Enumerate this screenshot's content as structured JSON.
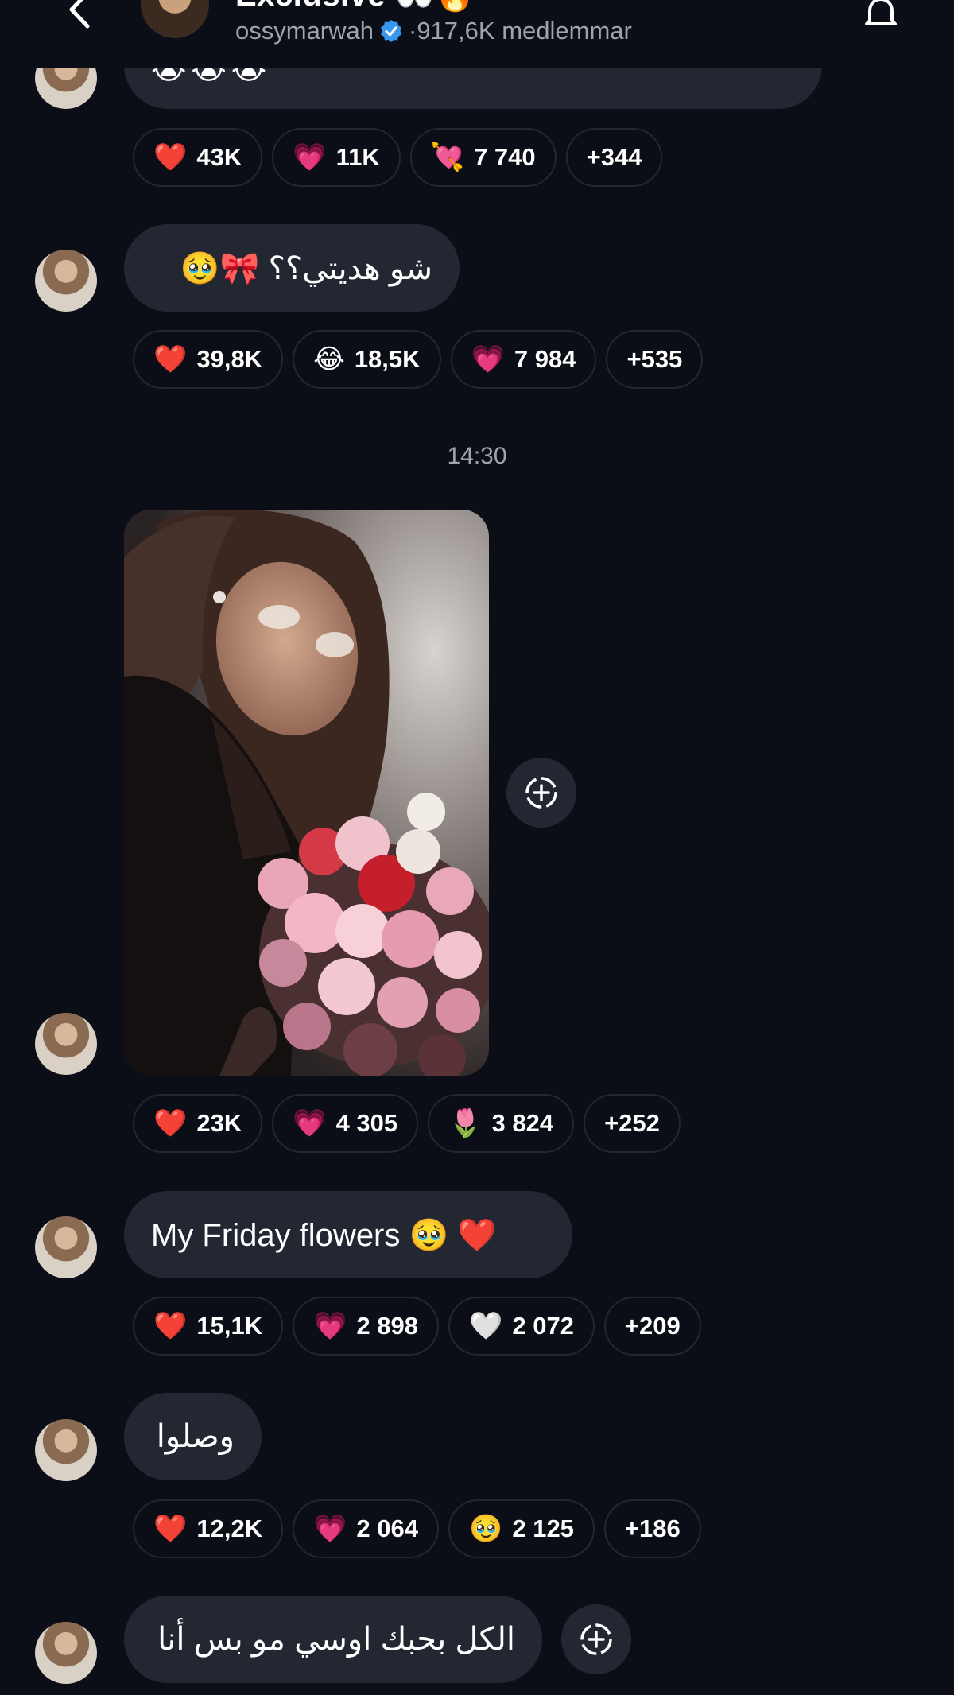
{
  "header": {
    "title": "Exclusive 👀🔥",
    "username": "ossymarwah",
    "members": "·917,6K medlemmar"
  },
  "colors": {
    "background": "#0b0e16",
    "bubble": "#232732",
    "muted_text": "#9ea3ad",
    "verified": "#3897f0"
  },
  "messages": [
    {
      "text": "😭😭😭",
      "reactions": [
        {
          "emoji": "❤️",
          "count": "43K"
        },
        {
          "emoji": "💗",
          "count": "11K"
        },
        {
          "emoji": "💘",
          "count": "7 740"
        },
        {
          "emoji": "",
          "count": "+344"
        }
      ]
    },
    {
      "text": "شو هديتي؟؟ 🎀🥹",
      "reactions": [
        {
          "emoji": "❤️",
          "count": "39,8K"
        },
        {
          "emoji": "😂",
          "count": "18,5K"
        },
        {
          "emoji": "💗",
          "count": "7 984"
        },
        {
          "emoji": "",
          "count": "+535"
        }
      ]
    },
    {
      "timestamp": "14:30",
      "photo": "selfie-with-flower-bouquet",
      "reactions": [
        {
          "emoji": "❤️",
          "count": "23K"
        },
        {
          "emoji": "💗",
          "count": "4 305"
        },
        {
          "emoji": "🌷",
          "count": "3 824"
        },
        {
          "emoji": "",
          "count": "+252"
        }
      ]
    },
    {
      "text": "My Friday flowers 🥹 ❤️",
      "reactions": [
        {
          "emoji": "❤️",
          "count": "15,1K"
        },
        {
          "emoji": "💗",
          "count": "2 898"
        },
        {
          "emoji": "🤍",
          "count": "2 072"
        },
        {
          "emoji": "",
          "count": "+209"
        }
      ]
    },
    {
      "text": "وصلوا",
      "reactions": [
        {
          "emoji": "❤️",
          "count": "12,2K"
        },
        {
          "emoji": "💗",
          "count": "2 064"
        },
        {
          "emoji": "🥹",
          "count": "2 125"
        },
        {
          "emoji": "",
          "count": "+186"
        }
      ]
    },
    {
      "text": "الكل بحبك اوسي مو بس أنا"
    }
  ]
}
